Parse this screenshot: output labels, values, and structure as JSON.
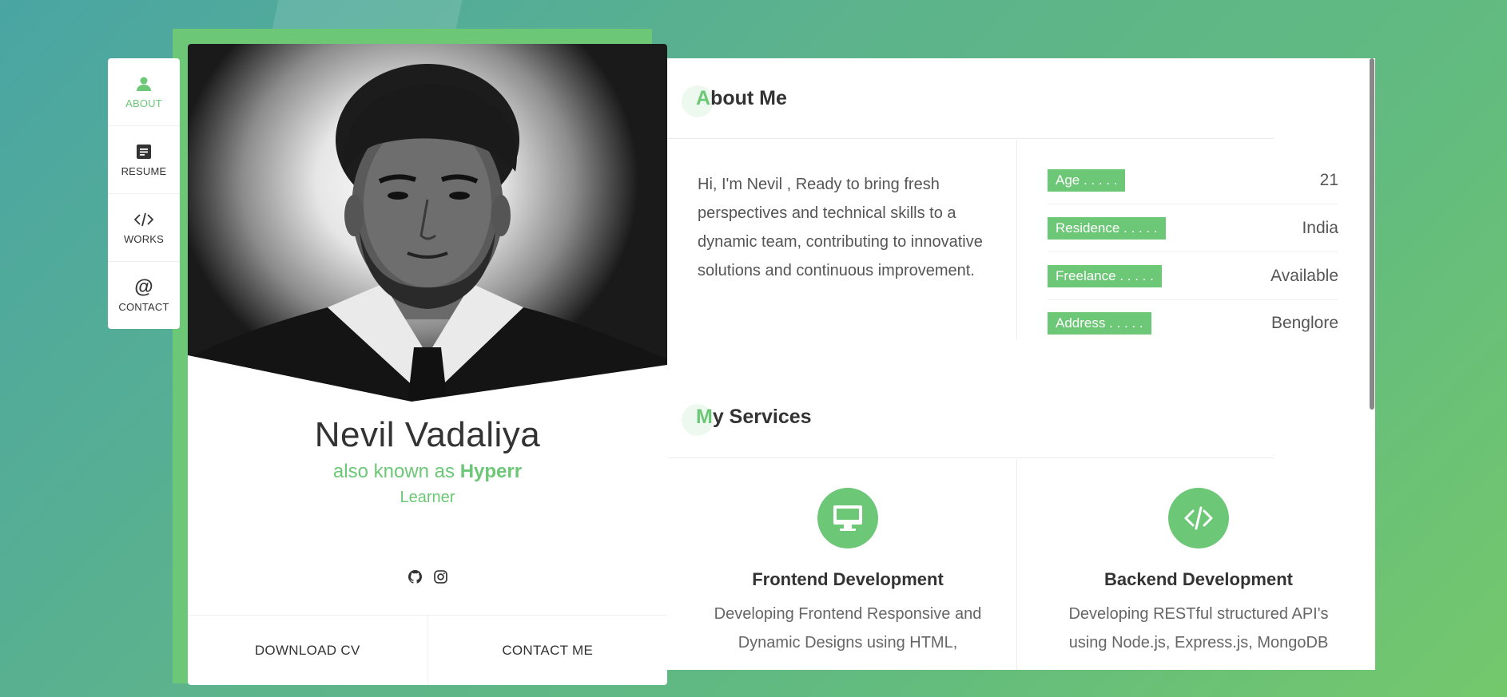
{
  "nav": {
    "items": [
      {
        "label": "ABOUT",
        "icon": "person-icon",
        "active": true
      },
      {
        "label": "RESUME",
        "icon": "document-icon",
        "active": false
      },
      {
        "label": "WORKS",
        "icon": "code-icon",
        "active": false
      },
      {
        "label": "CONTACT",
        "icon": "at-icon",
        "active": false
      }
    ]
  },
  "profile": {
    "name": "Nevil Vadaliya",
    "aka_prefix": "also known as ",
    "aka_name": "Hyperr",
    "role": "Learner",
    "socials": [
      "github-icon",
      "instagram-icon"
    ],
    "download_cv": "DOWNLOAD CV",
    "contact_me": "CONTACT ME"
  },
  "about": {
    "title_first": "A",
    "title_rest": "bout Me",
    "text": "Hi, I'm Nevil , Ready to bring fresh perspectives and technical skills to a dynamic team, contributing to innovative solutions and continuous improvement.",
    "info": [
      {
        "label": "Age . . . . .",
        "value": "21"
      },
      {
        "label": "Residence . . . . .",
        "value": "India"
      },
      {
        "label": "Freelance . . . . .",
        "value": "Available"
      },
      {
        "label": "Address . . . . .",
        "value": "Benglore"
      }
    ]
  },
  "services": {
    "title_first": "M",
    "title_rest": "y Services",
    "items": [
      {
        "icon": "monitor-icon",
        "title": "Frontend Development",
        "desc": "Developing Frontend Responsive and Dynamic Designs using HTML,"
      },
      {
        "icon": "code-icon",
        "title": "Backend Development",
        "desc": "Developing RESTful structured API's using Node.js, Express.js, MongoDB"
      }
    ]
  },
  "colors": {
    "accent": "#6cc776"
  }
}
